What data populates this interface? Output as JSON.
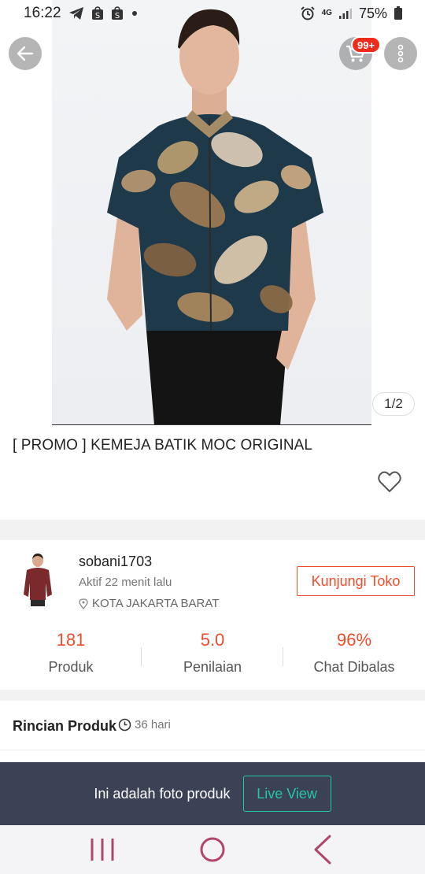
{
  "status_bar": {
    "time": "16:22",
    "network": "4G",
    "battery": "75%"
  },
  "hero": {
    "cart_badge": "99+",
    "page_indicator": "1/2"
  },
  "product": {
    "title": "[ PROMO ] KEMEJA BATIK MOC ORIGINAL"
  },
  "shop": {
    "name": "sobani1703",
    "active": "Aktif 22 menit lalu",
    "location": "KOTA JAKARTA BARAT",
    "visit_label": "Kunjungi Toko",
    "stats": [
      {
        "value": "181",
        "label": "Produk"
      },
      {
        "value": "5.0",
        "label": "Penilaian"
      },
      {
        "value": "96%",
        "label": "Chat Dibalas"
      }
    ]
  },
  "details": {
    "title": "Rincian Produk",
    "age": "36 hari"
  },
  "live": {
    "text": "Ini adalah foto produk",
    "button_label": "Live View"
  },
  "colors": {
    "accent": "#ee4d2d",
    "live_green": "#23c4a8",
    "banner_bg": "#3c4256",
    "nav_icon": "#b0466e"
  }
}
